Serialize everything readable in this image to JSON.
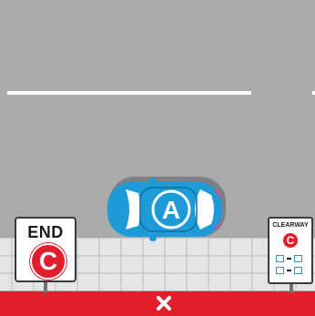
{
  "scene": {
    "colors": {
      "road": "#a9aaac",
      "lane_line": "#ffffff",
      "footpath": "#e3e5e6",
      "no_stopping_strip": "#e01e2c",
      "car_body": "#1e9ad6",
      "sign_red": "#e01e2c",
      "sign_box_blue": "#2a8fd6"
    },
    "car": {
      "label": "A"
    },
    "end_clearway_sign": {
      "word": "END",
      "letter": "C"
    },
    "clearway_sign": {
      "title": "CLEARWAY",
      "letter": "C",
      "time_rows": 2
    },
    "no_stopping_mark": {
      "icon": "x-icon"
    }
  }
}
